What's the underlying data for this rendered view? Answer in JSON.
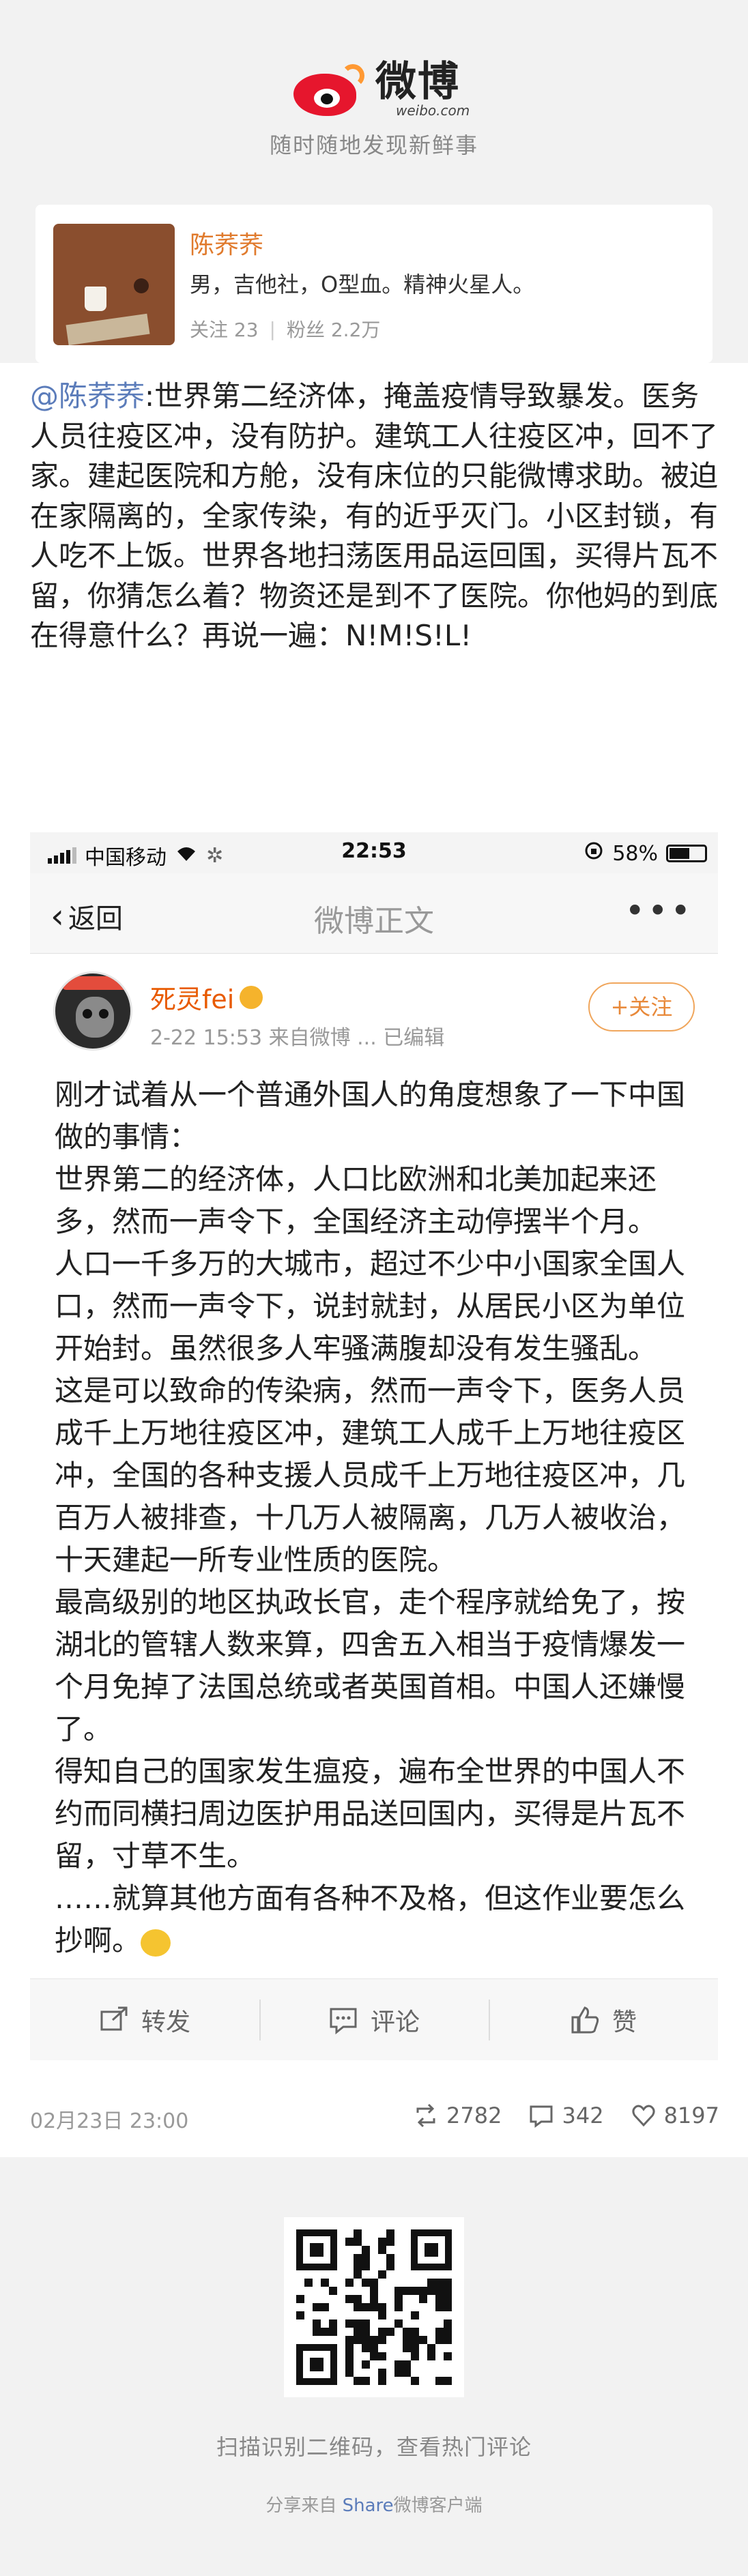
{
  "header": {
    "logo_text": "微博",
    "logo_sub": "weibo.com",
    "slogan": "随时随地发现新鲜事"
  },
  "profile": {
    "name": "陈荞荞",
    "bio": "男，吉他社，O型血。精神火星人。",
    "following_label": "关注 23",
    "followers_label": "粉丝 2.2万",
    "separator": "|"
  },
  "post": {
    "mention": "@陈荞荞",
    "text": ":世界第二经济体，掩盖疫情导致暴发。医务人员往疫区冲，没有防护。建筑工人往疫区冲，回不了家。建起医院和方舱，没有床位的只能微博求助。被迫在家隔离的，全家传染，有的近乎灭门。小区封锁，有人吃不上饭。世界各地扫荡医用品运回国，买得片瓦不留，你猜怎么着？物资还是到不了医院。你他妈的到底在得意什么？再说一遍：N!M!S!L!"
  },
  "screenshot": {
    "status": {
      "carrier": "中国移动",
      "time": "22:53",
      "battery": "58%",
      "battery_level": 0.58
    },
    "nav": {
      "back": "返回",
      "title": "微博正文",
      "more": "•••"
    },
    "author": {
      "name": "死灵fei",
      "meta": "2-22 15:53  来自微博 ... 已编辑",
      "follow": "+关注"
    },
    "paragraphs": [
      "刚才试着从一个普通外国人的角度想象了一下中国做的事情：",
      "世界第二的经济体，人口比欧洲和北美加起来还多，然而一声令下，全国经济主动停摆半个月。",
      "人口一千多万的大城市，超过不少中小国家全国人口，然而一声令下，说封就封，从居民小区为单位开始封。虽然很多人牢骚满腹却没有发生骚乱。",
      "这是可以致命的传染病，然而一声令下，医务人员成千上万地往疫区冲，建筑工人成千上万地往疫区冲，全国的各种支援人员成千上万地往疫区冲，几百万人被排查，十几万人被隔离，几万人被收治，十天建起一所专业性质的医院。",
      "最高级别的地区执政长官，走个程序就给免了，按湖北的管辖人数来算，四舍五入相当于疫情爆发一个月免掉了法国总统或者英国首相。中国人还嫌慢了。",
      "得知自己的国家发生瘟疫，遍布全世界的中国人不约而同横扫周边医护用品送回国内，买得是片瓦不留，寸草不生。",
      "……就算其他方面有各种不及格，但这作业要怎么抄啊。"
    ],
    "actions": {
      "repost": "转发",
      "comment": "评论",
      "like": "赞"
    }
  },
  "footer": {
    "date": "02月23日 23:00",
    "reposts": "2782",
    "comments": "342",
    "likes": "8197"
  },
  "bottom": {
    "qr_caption": "扫描识别二维码，查看热门评论",
    "share_prefix": "分享来自 ",
    "share_hl": "Share",
    "share_suffix": "微博客户端"
  }
}
